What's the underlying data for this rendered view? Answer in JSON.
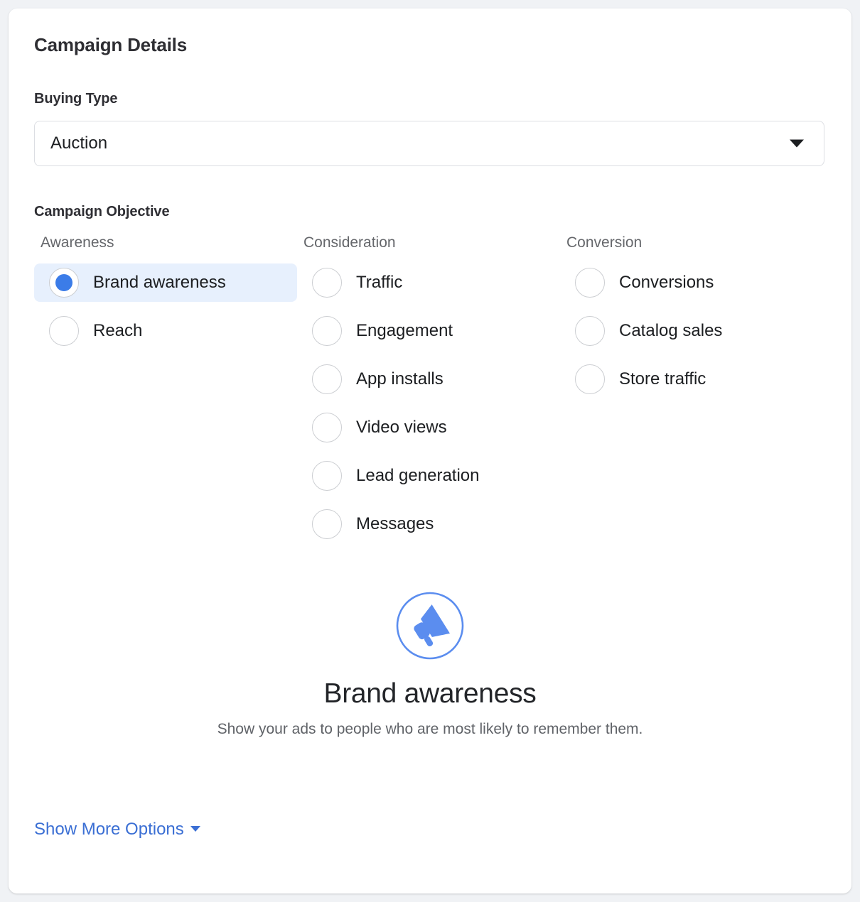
{
  "card": {
    "title": "Campaign Details"
  },
  "buying_type": {
    "label": "Buying Type",
    "value": "Auction",
    "caret_icon": "chevron-down-icon"
  },
  "objective": {
    "label": "Campaign Objective",
    "columns": [
      {
        "header": "Awareness",
        "options": [
          {
            "label": "Brand awareness",
            "selected": true
          },
          {
            "label": "Reach",
            "selected": false
          }
        ]
      },
      {
        "header": "Consideration",
        "options": [
          {
            "label": "Traffic",
            "selected": false
          },
          {
            "label": "Engagement",
            "selected": false
          },
          {
            "label": "App installs",
            "selected": false
          },
          {
            "label": "Video views",
            "selected": false
          },
          {
            "label": "Lead generation",
            "selected": false
          },
          {
            "label": "Messages",
            "selected": false
          }
        ]
      },
      {
        "header": "Conversion",
        "options": [
          {
            "label": "Conversions",
            "selected": false
          },
          {
            "label": "Catalog sales",
            "selected": false
          },
          {
            "label": "Store traffic",
            "selected": false
          }
        ]
      }
    ]
  },
  "preview": {
    "icon": "megaphone-icon",
    "title": "Brand awareness",
    "description": "Show your ads to people who are most likely to remember them."
  },
  "footer": {
    "more_options_label": "Show More Options",
    "more_options_caret": "caret-down-icon"
  },
  "colors": {
    "page_background": "#f0f2f5",
    "card_background": "#ffffff",
    "accent_blue": "#3b7ce8",
    "link_blue": "#3b6fd4",
    "selected_row_background": "#e7f0fd",
    "icon_blue": "#5b8def",
    "text_primary": "#1c1e21",
    "text_secondary": "#65676b"
  }
}
